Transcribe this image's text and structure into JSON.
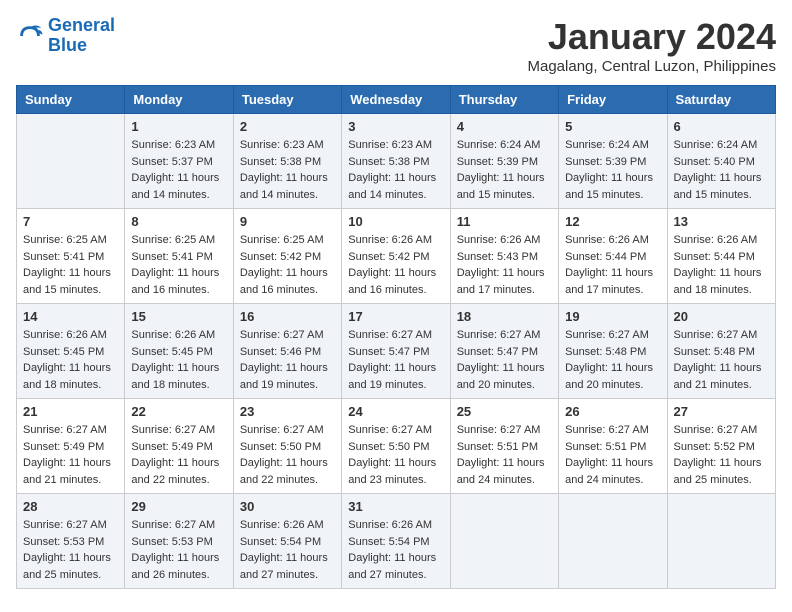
{
  "header": {
    "logo_line1": "General",
    "logo_line2": "Blue",
    "title": "January 2024",
    "subtitle": "Magalang, Central Luzon, Philippines"
  },
  "weekdays": [
    "Sunday",
    "Monday",
    "Tuesday",
    "Wednesday",
    "Thursday",
    "Friday",
    "Saturday"
  ],
  "weeks": [
    [
      {
        "day": "",
        "sunrise": "",
        "sunset": "",
        "daylight": ""
      },
      {
        "day": "1",
        "sunrise": "Sunrise: 6:23 AM",
        "sunset": "Sunset: 5:37 PM",
        "daylight": "Daylight: 11 hours and 14 minutes."
      },
      {
        "day": "2",
        "sunrise": "Sunrise: 6:23 AM",
        "sunset": "Sunset: 5:38 PM",
        "daylight": "Daylight: 11 hours and 14 minutes."
      },
      {
        "day": "3",
        "sunrise": "Sunrise: 6:23 AM",
        "sunset": "Sunset: 5:38 PM",
        "daylight": "Daylight: 11 hours and 14 minutes."
      },
      {
        "day": "4",
        "sunrise": "Sunrise: 6:24 AM",
        "sunset": "Sunset: 5:39 PM",
        "daylight": "Daylight: 11 hours and 15 minutes."
      },
      {
        "day": "5",
        "sunrise": "Sunrise: 6:24 AM",
        "sunset": "Sunset: 5:39 PM",
        "daylight": "Daylight: 11 hours and 15 minutes."
      },
      {
        "day": "6",
        "sunrise": "Sunrise: 6:24 AM",
        "sunset": "Sunset: 5:40 PM",
        "daylight": "Daylight: 11 hours and 15 minutes."
      }
    ],
    [
      {
        "day": "7",
        "sunrise": "Sunrise: 6:25 AM",
        "sunset": "Sunset: 5:41 PM",
        "daylight": "Daylight: 11 hours and 15 minutes."
      },
      {
        "day": "8",
        "sunrise": "Sunrise: 6:25 AM",
        "sunset": "Sunset: 5:41 PM",
        "daylight": "Daylight: 11 hours and 16 minutes."
      },
      {
        "day": "9",
        "sunrise": "Sunrise: 6:25 AM",
        "sunset": "Sunset: 5:42 PM",
        "daylight": "Daylight: 11 hours and 16 minutes."
      },
      {
        "day": "10",
        "sunrise": "Sunrise: 6:26 AM",
        "sunset": "Sunset: 5:42 PM",
        "daylight": "Daylight: 11 hours and 16 minutes."
      },
      {
        "day": "11",
        "sunrise": "Sunrise: 6:26 AM",
        "sunset": "Sunset: 5:43 PM",
        "daylight": "Daylight: 11 hours and 17 minutes."
      },
      {
        "day": "12",
        "sunrise": "Sunrise: 6:26 AM",
        "sunset": "Sunset: 5:44 PM",
        "daylight": "Daylight: 11 hours and 17 minutes."
      },
      {
        "day": "13",
        "sunrise": "Sunrise: 6:26 AM",
        "sunset": "Sunset: 5:44 PM",
        "daylight": "Daylight: 11 hours and 18 minutes."
      }
    ],
    [
      {
        "day": "14",
        "sunrise": "Sunrise: 6:26 AM",
        "sunset": "Sunset: 5:45 PM",
        "daylight": "Daylight: 11 hours and 18 minutes."
      },
      {
        "day": "15",
        "sunrise": "Sunrise: 6:26 AM",
        "sunset": "Sunset: 5:45 PM",
        "daylight": "Daylight: 11 hours and 18 minutes."
      },
      {
        "day": "16",
        "sunrise": "Sunrise: 6:27 AM",
        "sunset": "Sunset: 5:46 PM",
        "daylight": "Daylight: 11 hours and 19 minutes."
      },
      {
        "day": "17",
        "sunrise": "Sunrise: 6:27 AM",
        "sunset": "Sunset: 5:47 PM",
        "daylight": "Daylight: 11 hours and 19 minutes."
      },
      {
        "day": "18",
        "sunrise": "Sunrise: 6:27 AM",
        "sunset": "Sunset: 5:47 PM",
        "daylight": "Daylight: 11 hours and 20 minutes."
      },
      {
        "day": "19",
        "sunrise": "Sunrise: 6:27 AM",
        "sunset": "Sunset: 5:48 PM",
        "daylight": "Daylight: 11 hours and 20 minutes."
      },
      {
        "day": "20",
        "sunrise": "Sunrise: 6:27 AM",
        "sunset": "Sunset: 5:48 PM",
        "daylight": "Daylight: 11 hours and 21 minutes."
      }
    ],
    [
      {
        "day": "21",
        "sunrise": "Sunrise: 6:27 AM",
        "sunset": "Sunset: 5:49 PM",
        "daylight": "Daylight: 11 hours and 21 minutes."
      },
      {
        "day": "22",
        "sunrise": "Sunrise: 6:27 AM",
        "sunset": "Sunset: 5:49 PM",
        "daylight": "Daylight: 11 hours and 22 minutes."
      },
      {
        "day": "23",
        "sunrise": "Sunrise: 6:27 AM",
        "sunset": "Sunset: 5:50 PM",
        "daylight": "Daylight: 11 hours and 22 minutes."
      },
      {
        "day": "24",
        "sunrise": "Sunrise: 6:27 AM",
        "sunset": "Sunset: 5:50 PM",
        "daylight": "Daylight: 11 hours and 23 minutes."
      },
      {
        "day": "25",
        "sunrise": "Sunrise: 6:27 AM",
        "sunset": "Sunset: 5:51 PM",
        "daylight": "Daylight: 11 hours and 24 minutes."
      },
      {
        "day": "26",
        "sunrise": "Sunrise: 6:27 AM",
        "sunset": "Sunset: 5:51 PM",
        "daylight": "Daylight: 11 hours and 24 minutes."
      },
      {
        "day": "27",
        "sunrise": "Sunrise: 6:27 AM",
        "sunset": "Sunset: 5:52 PM",
        "daylight": "Daylight: 11 hours and 25 minutes."
      }
    ],
    [
      {
        "day": "28",
        "sunrise": "Sunrise: 6:27 AM",
        "sunset": "Sunset: 5:53 PM",
        "daylight": "Daylight: 11 hours and 25 minutes."
      },
      {
        "day": "29",
        "sunrise": "Sunrise: 6:27 AM",
        "sunset": "Sunset: 5:53 PM",
        "daylight": "Daylight: 11 hours and 26 minutes."
      },
      {
        "day": "30",
        "sunrise": "Sunrise: 6:26 AM",
        "sunset": "Sunset: 5:54 PM",
        "daylight": "Daylight: 11 hours and 27 minutes."
      },
      {
        "day": "31",
        "sunrise": "Sunrise: 6:26 AM",
        "sunset": "Sunset: 5:54 PM",
        "daylight": "Daylight: 11 hours and 27 minutes."
      },
      {
        "day": "",
        "sunrise": "",
        "sunset": "",
        "daylight": ""
      },
      {
        "day": "",
        "sunrise": "",
        "sunset": "",
        "daylight": ""
      },
      {
        "day": "",
        "sunrise": "",
        "sunset": "",
        "daylight": ""
      }
    ]
  ]
}
